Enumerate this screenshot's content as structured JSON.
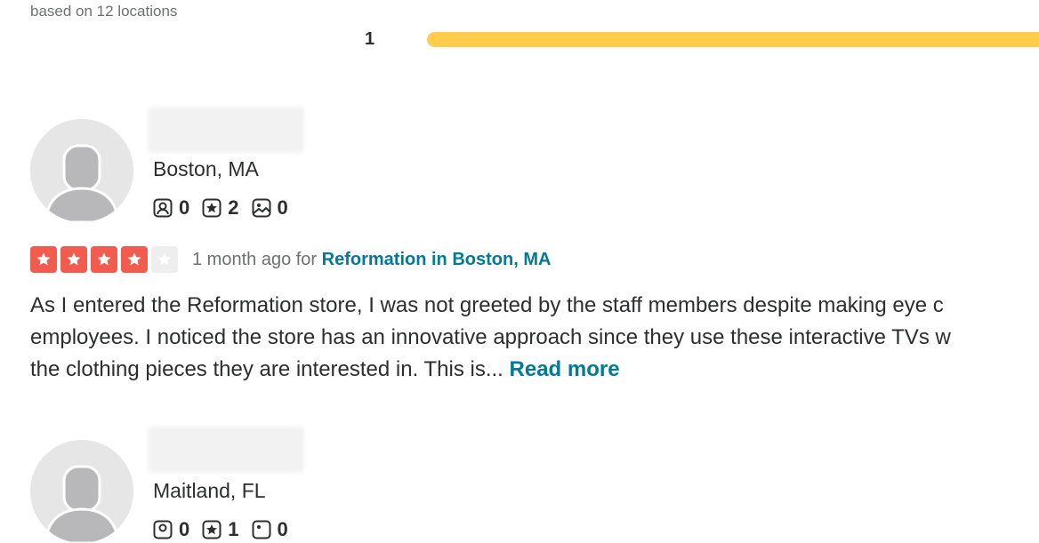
{
  "summary": {
    "note": "based on 12 locations",
    "distribution": [
      {
        "label": "1",
        "fill_fraction": 1.0,
        "color": "#ffcc4b"
      }
    ]
  },
  "reviews": [
    {
      "location": "Boston, MA",
      "stats": {
        "friends": "0",
        "reviews": "2",
        "photos": "0"
      },
      "rating": 4,
      "time_ago": "1 month ago for",
      "business": "Reformation in Boston, MA",
      "text_lines": [
        "As I entered the Reformation store, I was not greeted by the staff members despite making eye c",
        "employees. I noticed the store has an innovative approach since they use these interactive TVs w",
        "the clothing pieces they are interested in. This is..."
      ],
      "read_more": "Read more"
    },
    {
      "location": "Maitland, FL",
      "stats": {
        "friends": "0",
        "reviews": "1",
        "photos": "0"
      }
    }
  ],
  "colors": {
    "star_on": "#f15c4f",
    "star_off": "#eeeeee",
    "link": "#027a97",
    "bar": "#ffcc4b"
  },
  "icons": [
    "friends-icon",
    "review-star-icon",
    "photo-icon",
    "star-icon",
    "avatar-placeholder-icon"
  ]
}
